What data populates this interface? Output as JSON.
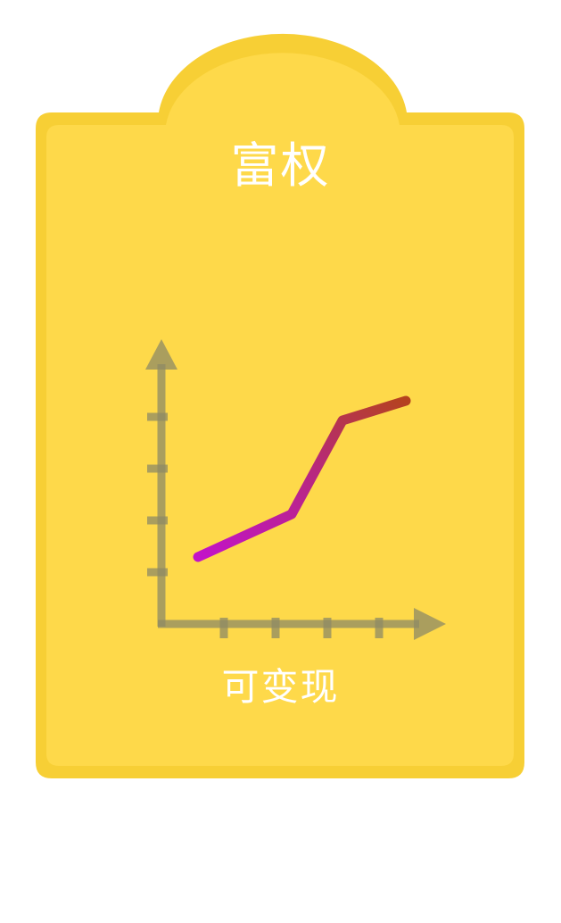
{
  "card": {
    "title": "富权",
    "caption": "可变现",
    "icon": "rising-line-chart-icon"
  },
  "colors": {
    "card_fill": "#FED94A",
    "card_inner": "#FFDB48",
    "card_border": "#F7CF35",
    "text": "#FFFFFF",
    "axis": "#8D8A66",
    "line_start": "#C213C9",
    "line_end": "#B5421F"
  }
}
